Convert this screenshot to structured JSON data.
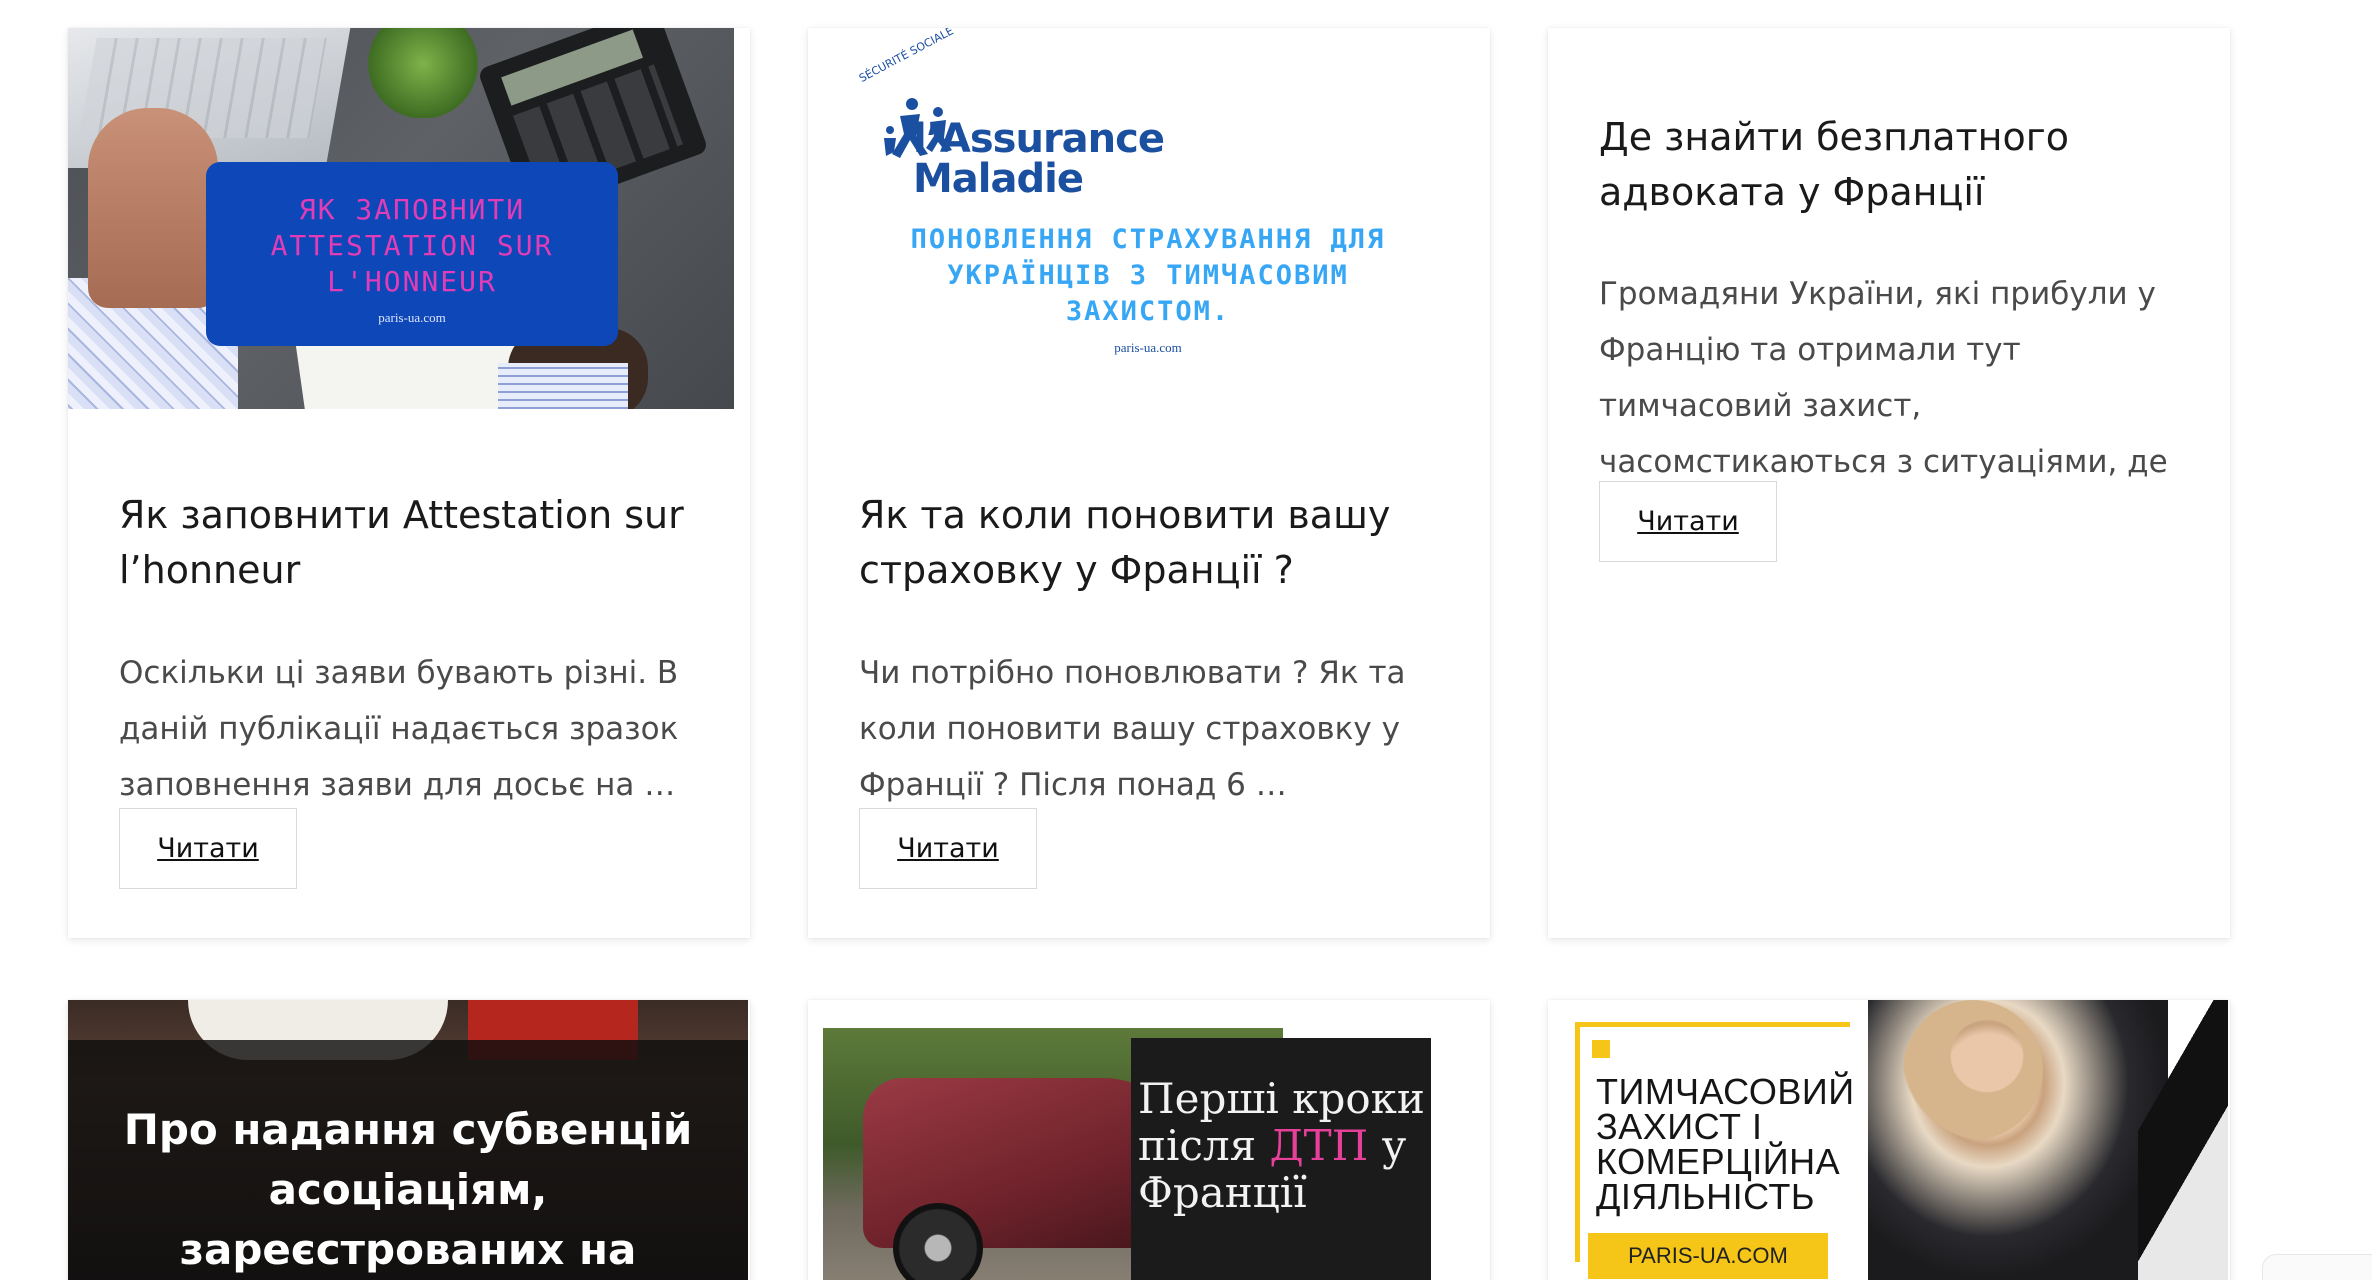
{
  "cards": [
    {
      "image": {
        "overlay_title": "ЯК ЗАПОВНИТИ ATTESTATION SUR L'HONNEUR",
        "site": "paris-ua.com"
      },
      "title": "Як заповнити Attestation sur l’honneur",
      "excerpt": "Оскільки ці заяви бувають різні.  В даній публікації надається зразок заповнення заяви для досьє на …",
      "read_label": "Читати"
    },
    {
      "image": {
        "logo_small": "SÉCURITÉ SOCIALE",
        "logo_line1": "l’Assurance",
        "logo_line2": "Maladie",
        "headline": "ПОНОВЛЕННЯ СТРАХУВАННЯ ДЛЯ УКРАЇНЦІВ З ТИМЧАСОВИМ ЗАХИСТОМ.",
        "site": "paris-ua.com"
      },
      "title": "Як та коли поновити вашу страховку у Франції ?",
      "excerpt": "Чи потрібно поновлювати ? Як та коли поновити вашу страховку у Франції ? Після понад 6 …",
      "read_label": "Читати"
    },
    {
      "title": "Де знайти безплатного адвоката у Франції",
      "excerpt": "Громадяни України, які прибули у Францію та отримали тут тимчасовий захист, часомстикаються з ситуаціями, де …",
      "read_label": "Читати"
    }
  ],
  "bottom_cards": [
    {
      "image_title": "Про надання субвенцій асоціаціям, зареєстрованих на території Франції"
    },
    {
      "image_title_part1": "Перші кроки після ",
      "image_title_highlight": "ДТП",
      "image_title_part2": " у Франції"
    },
    {
      "image_title": "ТИМЧАСОВИЙ ЗАХИСТ І КОМЕРЦІЙНА ДІЯЛЬНІСТЬ",
      "badge": "PARIS-UA.COM"
    }
  ],
  "colors": {
    "overlay_blue": "#0d47b8",
    "overlay_pink": "#e23cb7",
    "assurance_blue": "#1b4fa0",
    "headline_cyan": "#37a7f5",
    "highlight_pink": "#e6409a",
    "accent_yellow": "#f5c518"
  }
}
